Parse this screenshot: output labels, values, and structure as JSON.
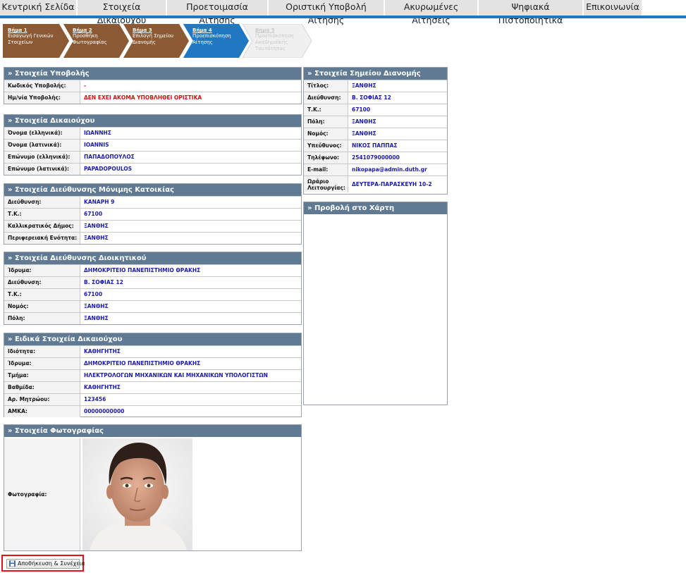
{
  "nav": {
    "tabs": [
      "Κεντρική Σελίδα",
      "Στοιχεία Δικαιούχου",
      "Προετοιμασία Αίτησης",
      "Οριστική Υποβολή Αίτησης",
      "Ακυρωμένες Αιτήσεις",
      "Ψηφιακά Πιστοποιητικά",
      "Επικοινωνία"
    ]
  },
  "steps": [
    {
      "title": "Βήμα 1",
      "text": "Εισαγωγή Γενικών Στοιχείων",
      "color": "#8b5a34"
    },
    {
      "title": "Βήμα 2",
      "text": "Προσθήκη Φωτογραφίας",
      "color": "#8b5a34"
    },
    {
      "title": "Βήμα 3",
      "text": "Επιλογή Σημείου Διανομής",
      "color": "#8b5a34"
    },
    {
      "title": "Βήμα 4",
      "text": "Προεπισκόπηση Αίτησης",
      "color": "#1f78c1"
    },
    {
      "title": "Βήμα 5",
      "text": "Προεπισκόπηση Ακαδημαϊκής Ταυτότητας",
      "color": "#f0f0f0"
    }
  ],
  "submission": {
    "header": "» Στοιχεία Υποβολής",
    "rows": [
      {
        "label": "Κωδικός Υποβολής:",
        "value": "-"
      },
      {
        "label": "Ημ/νία Υποβολής:",
        "value": "ΔΕΝ ΕΧΕΙ ΑΚΟΜΑ ΥΠΟΒΛΗΘΕΙ ΟΡΙΣΤΙΚΑ"
      }
    ]
  },
  "beneficiary": {
    "header": "» Στοιχεία Δικαιούχου",
    "rows": [
      {
        "label": "Όνομα (ελληνικά):",
        "value": "ΙΩΑΝΝΗΣ"
      },
      {
        "label": "Όνομα (λατινικά):",
        "value": "IOANNIS"
      },
      {
        "label": "Επώνυμο (ελληνικά):",
        "value": "ΠΑΠΑΔΟΠΟΥΛΟΣ"
      },
      {
        "label": "Επώνυμο (λατινικά):",
        "value": "PAPADOPOULOS"
      }
    ]
  },
  "residence": {
    "header": "» Στοιχεία Διεύθυνσης Μόνιμης Κατοικίας",
    "rows": [
      {
        "label": "Διεύθυνση:",
        "value": "ΚΑΝΑΡΗ 9"
      },
      {
        "label": "Τ.Κ.:",
        "value": "67100"
      },
      {
        "label": "Καλλικρατικός Δήμος:",
        "value": "ΞΑΝΘΗΣ"
      },
      {
        "label": "Περιφερειακή Ενότητα:",
        "value": "ΞΑΝΘΗΣ"
      }
    ]
  },
  "administration": {
    "header": "» Στοιχεία Διεύθυνσης Διοικητικού",
    "rows": [
      {
        "label": "Ίδρυμα:",
        "value": "ΔΗΜΟΚΡΙΤΕΙΟ ΠΑΝΕΠΙΣΤΗΜΙΟ ΘΡΑΚΗΣ"
      },
      {
        "label": "Διεύθυνση:",
        "value": "Β. ΣΟΦΙΑΣ 12"
      },
      {
        "label": "Τ.Κ.:",
        "value": "67100"
      },
      {
        "label": "Νομός:",
        "value": "ΞΑΝΘΗΣ"
      },
      {
        "label": "Πόλη:",
        "value": "ΞΑΝΘΗΣ"
      }
    ]
  },
  "special": {
    "header": "» Ειδικά Στοιχεία Δικαιούχου",
    "rows": [
      {
        "label": "Ιδιότητα:",
        "value": "ΚΑΘΗΓΗΤΗΣ"
      },
      {
        "label": "Ίδρυμα:",
        "value": "ΔΗΜΟΚΡΙΤΕΙΟ ΠΑΝΕΠΙΣΤΗΜΙΟ ΘΡΑΚΗΣ"
      },
      {
        "label": "Τμήμα:",
        "value": "ΗΛΕΚΤΡΟΛΟΓΩΝ ΜΗΧΑΝΙΚΩΝ ΚΑΙ ΜΗΧΑΝΙΚΩΝ ΥΠΟΛΟΓΙΣΤΩΝ"
      },
      {
        "label": "Βαθμίδα:",
        "value": "ΚΑΘΗΓΗΤΗΣ"
      },
      {
        "label": "Αρ. Μητρώου:",
        "value": "123456"
      },
      {
        "label": "ΑΜΚΑ:",
        "value": "00000000000"
      }
    ]
  },
  "photo": {
    "header": "» Στοιχεία Φωτογραφίας",
    "label": "Φωτογραφία:"
  },
  "distribution": {
    "header": "» Στοιχεία Σημείου Διανομής",
    "rows": [
      {
        "label": "Τίτλος:",
        "value": "ΞΑΝΘΗΣ"
      },
      {
        "label": "Διεύθυνση:",
        "value": "Β. ΣΟΦΙΑΣ 12"
      },
      {
        "label": "Τ.Κ.:",
        "value": "67100"
      },
      {
        "label": "Πόλη:",
        "value": "ΞΑΝΘΗΣ"
      },
      {
        "label": "Νομός:",
        "value": "ΞΑΝΘΗΣ"
      },
      {
        "label": "Υπεύθυνος:",
        "value": "ΝΙΚΟΣ ΠΑΠΠΑΣ"
      },
      {
        "label": "Τηλέφωνο:",
        "value": "2541079000000"
      },
      {
        "label": "E-mail:",
        "value": "nikopapa@admin.duth.gr"
      },
      {
        "label": "Ωράριο Λειτουργίας:",
        "value": "ΔΕΥΤΕΡΑ-ΠΑΡΑΣΚΕΥΗ 10-2"
      }
    ]
  },
  "map": {
    "header": "» Προβολή στο Χάρτη"
  },
  "actions": {
    "save_label": "Αποθήκευση & Συνέχεια"
  }
}
